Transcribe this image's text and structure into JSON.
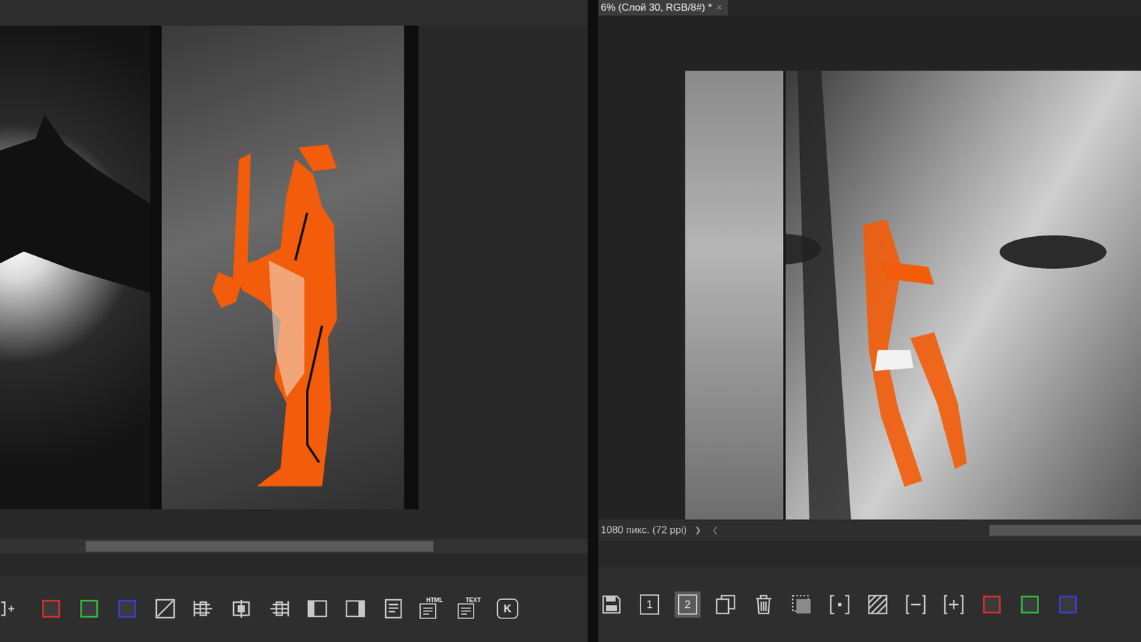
{
  "right_document": {
    "tab_title": "6% (Слой 30, RGB/8#) *",
    "close": "×",
    "status": "1080 пикс. (72 ppi)",
    "next": "❯",
    "prev": "❮"
  },
  "left_toolbar": [
    {
      "kind": "partial"
    },
    {
      "kind": "swatch",
      "color": "#d0312d"
    },
    {
      "kind": "swatch",
      "color": "#2fb340"
    },
    {
      "kind": "swatch",
      "color": "#3b3bd1"
    },
    {
      "kind": "slash"
    },
    {
      "kind": "align-left"
    },
    {
      "kind": "align-center"
    },
    {
      "kind": "align-right"
    },
    {
      "kind": "panel-left"
    },
    {
      "kind": "panel-right"
    },
    {
      "kind": "doc"
    },
    {
      "kind": "doc-label",
      "label": "HTML"
    },
    {
      "kind": "doc-label",
      "label": "TEXT"
    },
    {
      "kind": "badge",
      "label": "K"
    }
  ],
  "right_toolbar": [
    {
      "kind": "save",
      "selected": false
    },
    {
      "kind": "page",
      "label": "1",
      "selected": false
    },
    {
      "kind": "page",
      "label": "2",
      "selected": true
    },
    {
      "kind": "copy",
      "selected": false
    },
    {
      "kind": "trash",
      "selected": false
    },
    {
      "kind": "select",
      "selected": false
    },
    {
      "kind": "bracket",
      "selected": false
    },
    {
      "kind": "hatch",
      "selected": false
    },
    {
      "kind": "minus",
      "selected": false
    },
    {
      "kind": "plus",
      "selected": false
    },
    {
      "kind": "swatch",
      "color": "#d0312d",
      "selected": false
    },
    {
      "kind": "swatch",
      "color": "#2fb340",
      "selected": false
    },
    {
      "kind": "swatch",
      "color": "#3b3bd1",
      "selected": false
    }
  ]
}
